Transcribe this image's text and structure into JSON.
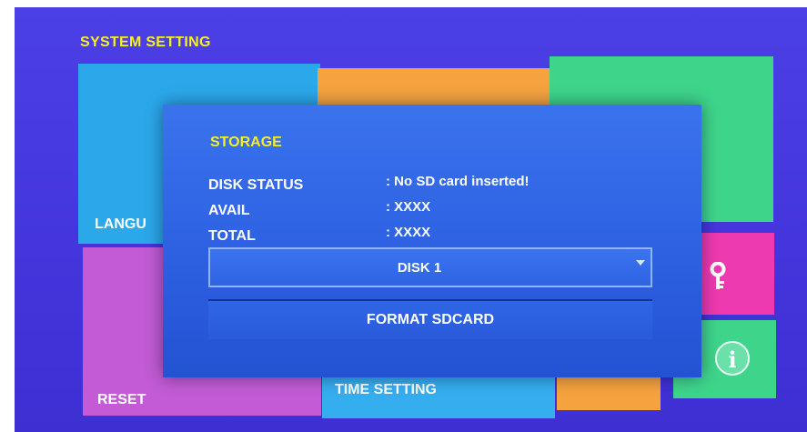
{
  "header": {
    "title": "SYSTEM SETTING"
  },
  "tiles": {
    "language": "LANGU",
    "reset": "RESET",
    "time_setting": "TIME SETTING"
  },
  "icons": {
    "key": "key-icon",
    "info": "info-icon"
  },
  "colors": {
    "background": "#4438dd",
    "dialog": "#2f66e6",
    "title_accent": "#f4f01c",
    "tile_blue": "#2ba8ea",
    "tile_orange": "#f5a33e",
    "tile_green": "#3ed58b",
    "tile_purple": "#c25bd5",
    "tile_pink": "#ee3ab0"
  },
  "dialog": {
    "title": "STORAGE",
    "rows": [
      {
        "label": "DISK STATUS",
        "value": ": No SD card inserted!"
      },
      {
        "label": "AVAIL",
        "value": ": XXXX"
      },
      {
        "label": "TOTAL",
        "value": ": XXXX"
      }
    ],
    "disk_select": {
      "value": "DISK 1"
    },
    "format_button": "FORMAT SDCARD"
  }
}
